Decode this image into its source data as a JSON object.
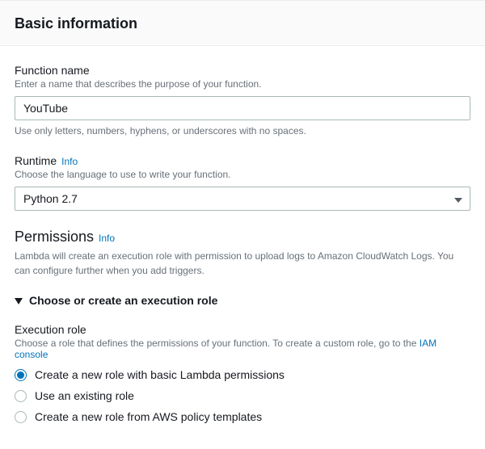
{
  "header": {
    "title": "Basic information"
  },
  "functionName": {
    "label": "Function name",
    "desc": "Enter a name that describes the purpose of your function.",
    "value": "YouTube",
    "help": "Use only letters, numbers, hyphens, or underscores with no spaces."
  },
  "runtime": {
    "label": "Runtime",
    "info": "Info",
    "desc": "Choose the language to use to write your function.",
    "value": "Python 2.7"
  },
  "permissions": {
    "title": "Permissions",
    "info": "Info",
    "desc": "Lambda will create an execution role with permission to upload logs to Amazon CloudWatch Logs. You can configure further when you add triggers."
  },
  "executionRole": {
    "expandLabel": "Choose or create an execution role",
    "label": "Execution role",
    "descPrefix": "Choose a role that defines the permissions of your function. To create a custom role, go to the ",
    "iamLink": "IAM console",
    "options": [
      {
        "label": "Create a new role with basic Lambda permissions",
        "checked": true
      },
      {
        "label": "Use an existing role",
        "checked": false
      },
      {
        "label": "Create a new role from AWS policy templates",
        "checked": false
      }
    ]
  }
}
